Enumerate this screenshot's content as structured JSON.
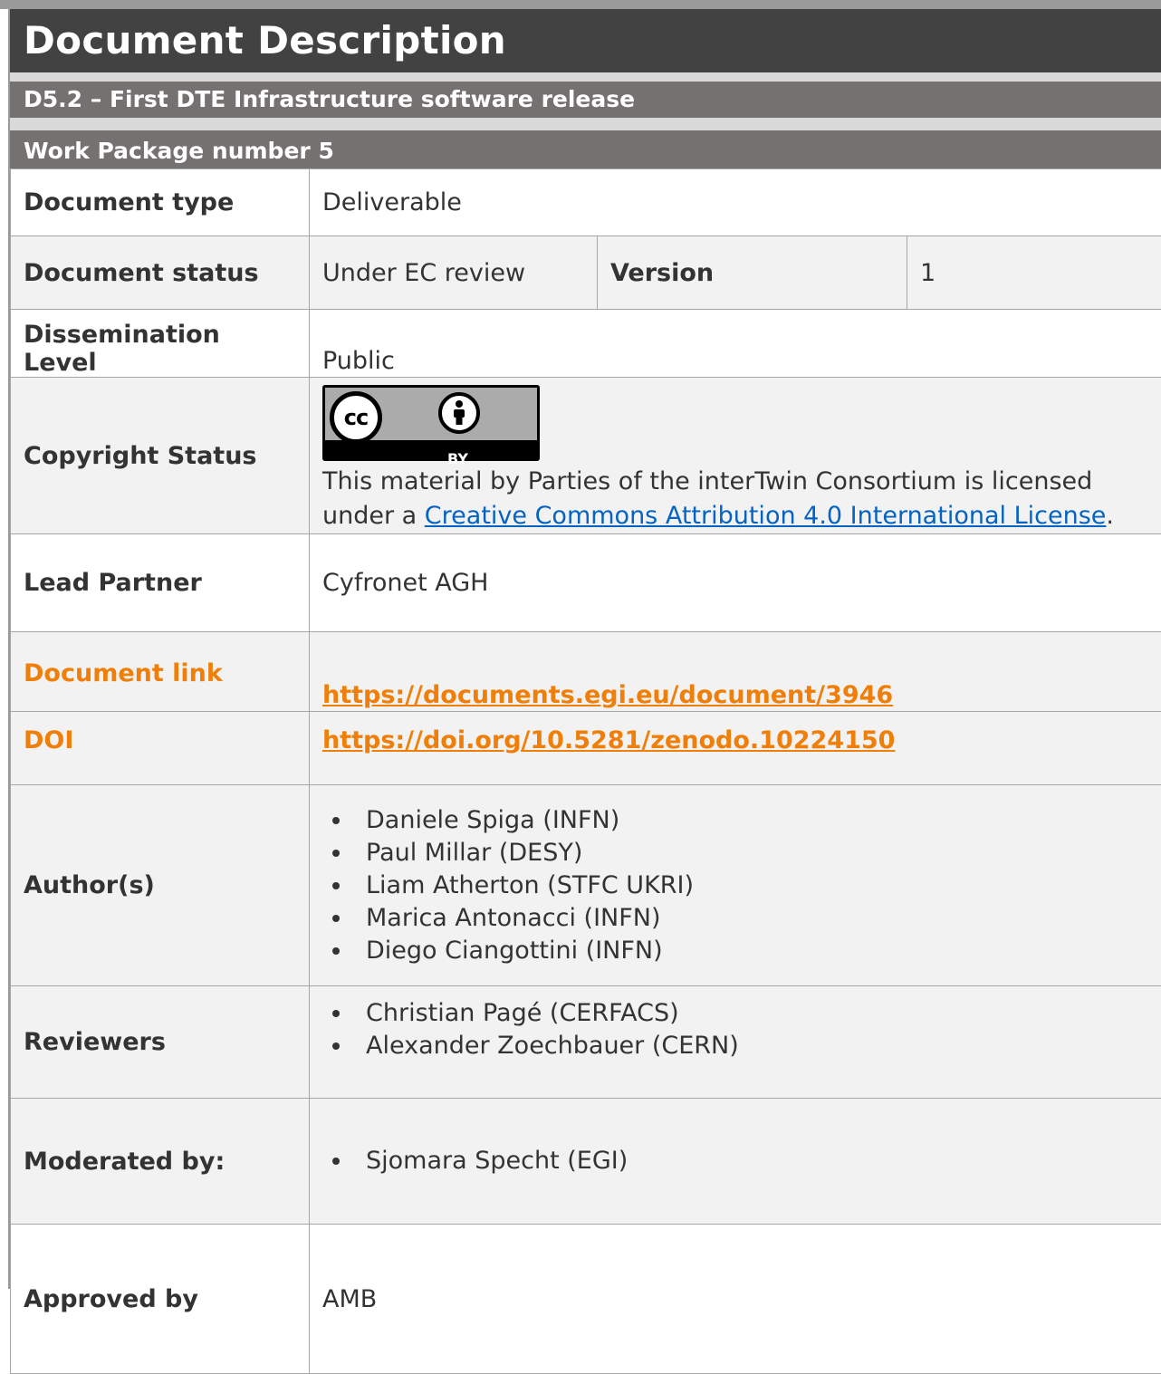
{
  "header": {
    "title": "Document Description",
    "deliverable": "D5.2 – First DTE Infrastructure software release",
    "work_package": "Work Package number 5"
  },
  "rows": {
    "document_type": {
      "label": "Document type",
      "value": "Deliverable"
    },
    "document_status": {
      "label": "Document status",
      "value": "Under EC review",
      "version_label": "Version",
      "version_value": "1"
    },
    "dissemination": {
      "label": "Dissemination Level",
      "value": "Public"
    },
    "copyright": {
      "label": "Copyright Status",
      "badge_cc": "cc",
      "badge_by": "BY",
      "text_before": "This material by Parties of the interTwin Consortium is licensed under a ",
      "link_text": "Creative Commons Attribution 4.0 International License",
      "text_after": "."
    },
    "lead_partner": {
      "label": "Lead Partner",
      "value": "Cyfronet AGH"
    },
    "document_link": {
      "label": "Document link",
      "value": "https://documents.egi.eu/document/3946"
    },
    "doi": {
      "label": "DOI",
      "value": "https://doi.org/10.5281/zenodo.10224150"
    },
    "authors": {
      "label": "Author(s)",
      "items": [
        "Daniele Spiga (INFN)",
        "Paul Millar (DESY)",
        "Liam Atherton (STFC UKRI)",
        "Marica Antonacci (INFN)",
        "Diego Ciangottini (INFN)"
      ]
    },
    "reviewers": {
      "label": "Reviewers",
      "items": [
        "Christian Pagé (CERFACS)",
        "Alexander Zoechbauer (CERN)"
      ]
    },
    "moderated": {
      "label": "Moderated by:",
      "items": [
        "Sjomara Specht (EGI)"
      ]
    },
    "approved": {
      "label": "Approved by",
      "value": "AMB"
    }
  },
  "colors": {
    "title_bg": "#424242",
    "sub_bg": "#767171",
    "accent_orange": "#f07f09",
    "link_blue": "#0563c1"
  }
}
